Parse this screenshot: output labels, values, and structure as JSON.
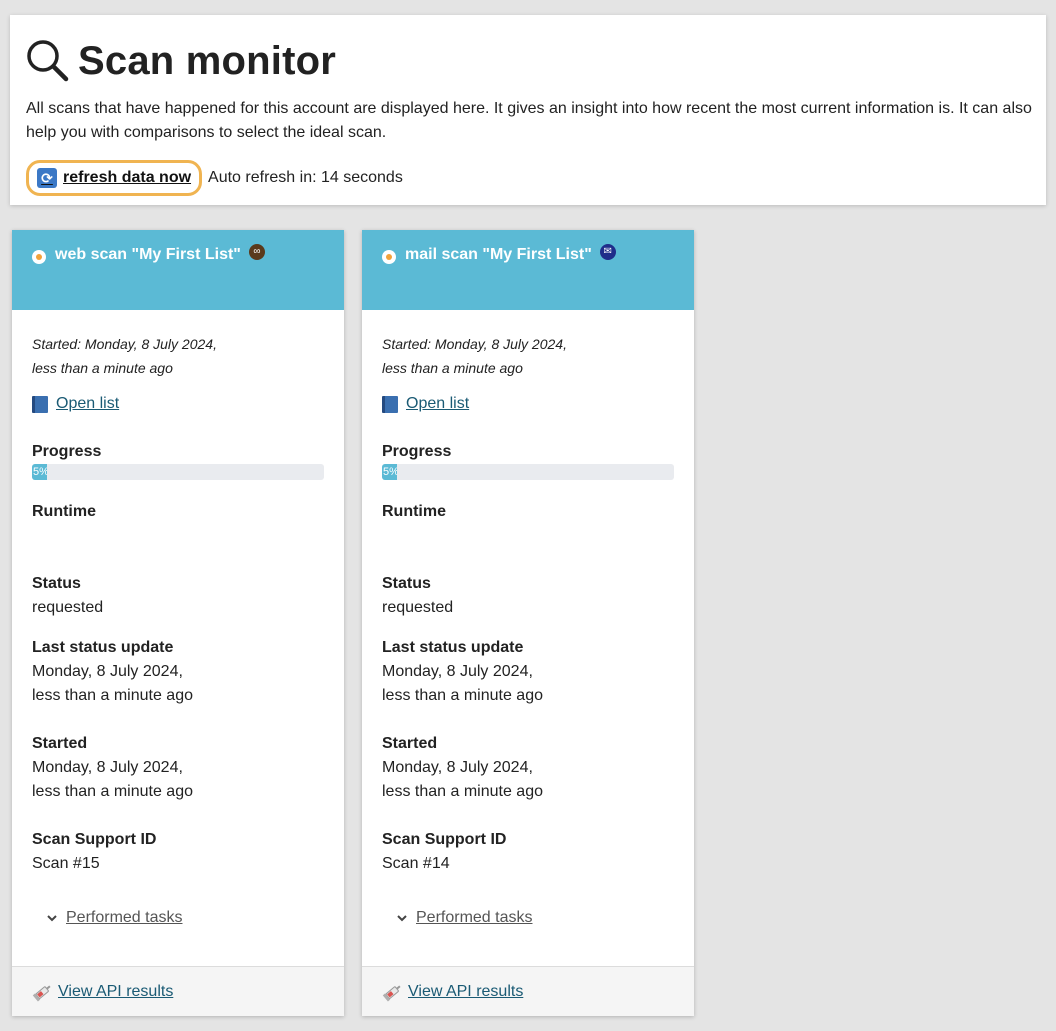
{
  "header": {
    "title": "Scan monitor",
    "description": "All scans that have happened for this account are displayed here. It gives an insight into how recent the most current information is. It can also help you with comparisons to select the ideal scan.",
    "refresh_label": "refresh data now",
    "auto_refresh": "Auto refresh in: 14 seconds",
    "accent_color": "#f0b451"
  },
  "scans": [
    {
      "title": "web scan \"My First List\"",
      "type_icon": "link-icon",
      "started_meta_line1": "Started: Monday, 8 July 2024,",
      "started_meta_line2": "less than a minute ago",
      "open_list": "Open list",
      "progress_label": "Progress",
      "progress_percent": 5,
      "progress_text": "5%",
      "runtime_label": "Runtime",
      "runtime_value": "",
      "status_label": "Status",
      "status_value": "requested",
      "last_update_label": "Last status update",
      "last_update_line1": "Monday, 8 July 2024,",
      "last_update_line2": "less than a minute ago",
      "started_label": "Started",
      "started_line1": "Monday, 8 July 2024,",
      "started_line2": "less than a minute ago",
      "support_label": "Scan Support ID",
      "support_value": "Scan #15",
      "tasks_label": "Performed tasks",
      "api_label": "View API results"
    },
    {
      "title": "mail scan \"My First List\"",
      "type_icon": "envelope-icon",
      "started_meta_line1": "Started: Monday, 8 July 2024,",
      "started_meta_line2": "less than a minute ago",
      "open_list": "Open list",
      "progress_label": "Progress",
      "progress_percent": 5,
      "progress_text": "5%",
      "runtime_label": "Runtime",
      "runtime_value": "",
      "status_label": "Status",
      "status_value": "requested",
      "last_update_label": "Last status update",
      "last_update_line1": "Monday, 8 July 2024,",
      "last_update_line2": "less than a minute ago",
      "started_label": "Started",
      "started_line1": "Monday, 8 July 2024,",
      "started_line2": "less than a minute ago",
      "support_label": "Scan Support ID",
      "support_value": "Scan #14",
      "tasks_label": "Performed tasks",
      "api_label": "View API results"
    }
  ],
  "colors": {
    "card_header": "#5bbad5",
    "link": "#1a5a74",
    "background": "#e4e4e4"
  }
}
